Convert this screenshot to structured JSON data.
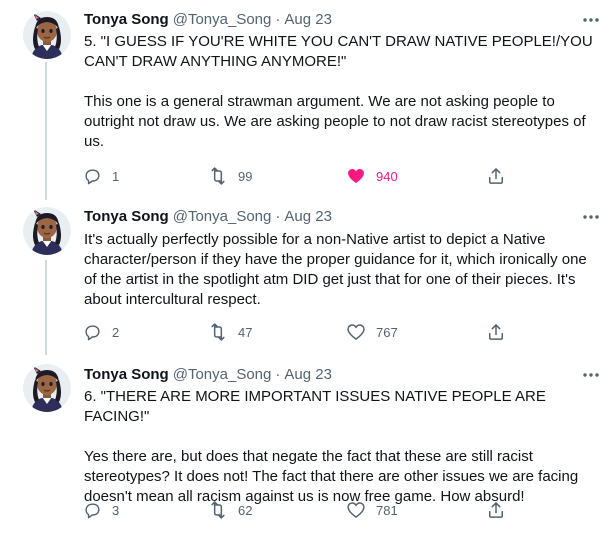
{
  "colors": {
    "text": "#0f1419",
    "muted": "#536471",
    "like_active": "#f91880",
    "thread_line": "#cfd9de"
  },
  "icons": {
    "reply": "reply-icon",
    "retweet": "retweet-icon",
    "like": "heart-icon",
    "share": "share-icon",
    "more": "more-dots-icon"
  },
  "tweets": [
    {
      "author": {
        "display_name": "Tonya Song",
        "handle": "@Tonya_Song"
      },
      "separator": "·",
      "date": "Aug 23",
      "paragraphs": [
        "5. \"I GUESS IF YOU'RE WHITE YOU CAN'T DRAW NATIVE PEOPLE!/YOU CAN'T DRAW ANYTHING ANYMORE!\"",
        "This one is a general strawman argument. We are not asking people to outright not draw us. We are asking people to not draw racist stereotypes of us."
      ],
      "replies": "1",
      "retweets": "99",
      "likes": "940",
      "liked": true
    },
    {
      "author": {
        "display_name": "Tonya Song",
        "handle": "@Tonya_Song"
      },
      "separator": "·",
      "date": "Aug 23",
      "paragraphs": [
        "It's actually perfectly possible for a non-Native artist to depict a Native character/person if they have the proper guidance for it, which ironically one of the artist in the spotlight atm DID get just that for one of their pieces. It's about intercultural respect."
      ],
      "replies": "2",
      "retweets": "47",
      "likes": "767",
      "liked": false
    },
    {
      "author": {
        "display_name": "Tonya Song",
        "handle": "@Tonya_Song"
      },
      "separator": "·",
      "date": "Aug 23",
      "paragraphs": [
        "6. \"THERE ARE MORE IMPORTANT ISSUES NATIVE PEOPLE ARE FACING!\"",
        "Yes there are, but does that negate the fact that these are still racist stereotypes? It does not! The fact that there are other issues we are facing doesn't mean all racism against us is now free game. How absurd!"
      ],
      "replies": "3",
      "retweets": "62",
      "likes": "781",
      "liked": false
    }
  ]
}
